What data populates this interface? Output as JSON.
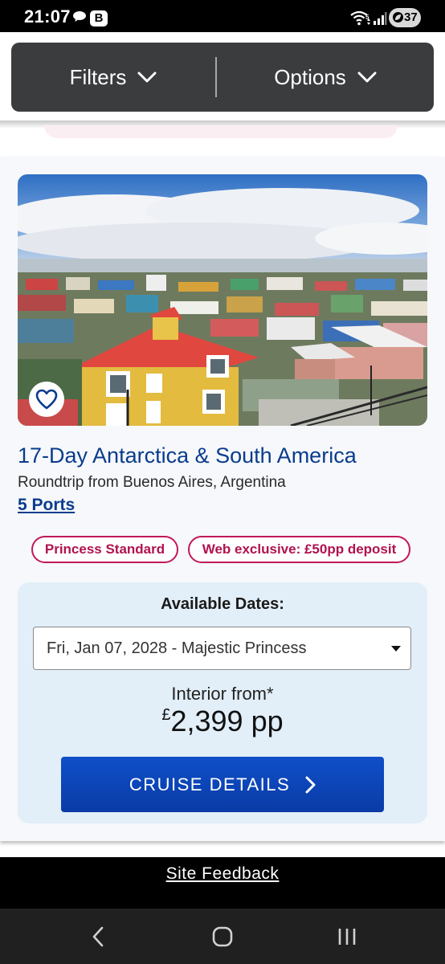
{
  "status_bar": {
    "time": "21:07",
    "b_badge": "B",
    "battery": "37",
    "icons": [
      "chat-bubble-icon",
      "wifi-icon",
      "signal-icon",
      "battery-saver-icon"
    ]
  },
  "filter_bar": {
    "filters_label": "Filters",
    "options_label": "Options"
  },
  "cruise": {
    "image_alt": "Colorful town view with yellow house and red roof",
    "title": "17-Day Antarctica & South America",
    "route": "Roundtrip from Buenos Aires, Argentina",
    "ports": "5 Ports",
    "badges": [
      "Princess Standard",
      "Web exclusive: £50pp deposit"
    ],
    "dates_label": "Available Dates:",
    "selected_date": "Fri, Jan 07, 2028 - Majestic Princess",
    "price_label": "Interior from*",
    "price_currency": "£",
    "price_amount": "2,399 pp",
    "details_button": "CRUISE DETAILS"
  },
  "footer": {
    "feedback": "Site Feedback"
  },
  "colors": {
    "title_blue": "#0a3c8c",
    "badge_pink": "#c2185b",
    "button_blue": "#0f4fc9",
    "panel_blue": "#e2eef8"
  }
}
